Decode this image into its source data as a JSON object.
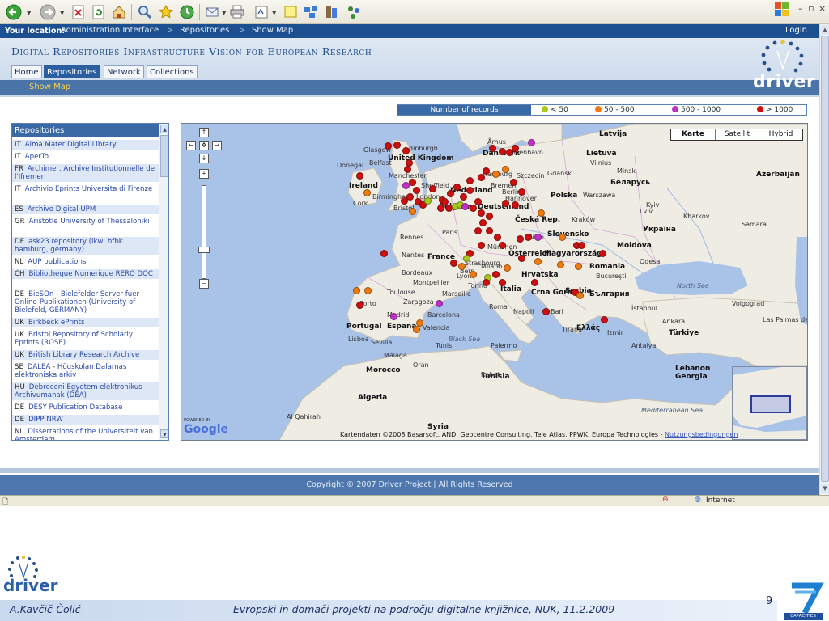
{
  "location_bar": {
    "label": "Your location:",
    "crumbs": [
      "Administration Interface",
      "Repositories",
      "Show Map"
    ],
    "separator": ">",
    "login": "Login"
  },
  "header": {
    "title": "Digital Repositories Infrastructure Vision for European Research",
    "tabs": [
      "Home",
      "Repositories",
      "Network",
      "Collections"
    ],
    "active_tab": "Repositories",
    "sub_link": "Show Map",
    "logo_text": "driver"
  },
  "legend": {
    "heading": "Number of records",
    "items": [
      {
        "label": "< 50",
        "color": "#a8c81c"
      },
      {
        "label": "50 - 500",
        "color": "#f07a12"
      },
      {
        "label": "500 - 1000",
        "color": "#c030c8"
      },
      {
        "label": "> 1000",
        "color": "#cc1010"
      }
    ]
  },
  "repositories": {
    "heading": "Repositories",
    "items": [
      {
        "cc": "IT",
        "name": "Alma Mater Digital Library"
      },
      {
        "cc": "IT",
        "name": "AperTo"
      },
      {
        "cc": "FR",
        "name": "Archimer, Archive Institutionnelle de l'Ifremer"
      },
      {
        "cc": "IT",
        "name": "Archivio Eprints Universita di Firenze"
      },
      {
        "cc": "ES",
        "name": "Archivo Digital UPM"
      },
      {
        "cc": "GR",
        "name": "Aristotle University of Thessaloniki"
      },
      {
        "cc": "DE",
        "name": "ask23 repository (lkw, hfbk hamburg, germany)"
      },
      {
        "cc": "NL",
        "name": "AUP publications"
      },
      {
        "cc": "CH",
        "name": "Bibliotheque Numerique RERO DOC"
      },
      {
        "cc": "DE",
        "name": "BieSOn - Bielefelder Server fuer Online-Publikationen (University of Bielefeld, GERMANY)"
      },
      {
        "cc": "UK",
        "name": "Birkbeck ePrints"
      },
      {
        "cc": "UK",
        "name": "Bristol Repository of Scholarly Eprints (ROSE)"
      },
      {
        "cc": "UK",
        "name": "British Library Research Archive"
      },
      {
        "cc": "SE",
        "name": "DALEA - Högskolan Dalarnas elektroniska arkiv"
      },
      {
        "cc": "HU",
        "name": "Debreceni Egyetem elektronikus Archivumanak (DEA)"
      },
      {
        "cc": "DE",
        "name": "DESY Publication Database"
      },
      {
        "cc": "DE",
        "name": "DIPP NRW"
      },
      {
        "cc": "NL",
        "name": "Dissertations of the Universiteit van Amsterdam"
      }
    ]
  },
  "map": {
    "type_buttons": [
      "Karte",
      "Satellit",
      "Hybrid"
    ],
    "selected_type": "Karte",
    "labels": [
      {
        "t": "Latvija",
        "c": "country"
      },
      {
        "t": "Danmark",
        "c": "country"
      },
      {
        "t": "København",
        "c": "city"
      },
      {
        "t": "Århus",
        "c": "city"
      },
      {
        "t": "Lietuva",
        "c": "country"
      },
      {
        "t": "Vilnius",
        "c": "city"
      },
      {
        "t": "Minsk",
        "c": "city"
      },
      {
        "t": "Беларусь",
        "c": "country"
      },
      {
        "t": "Glasgow",
        "c": "city"
      },
      {
        "t": "Edinburgh",
        "c": "city"
      },
      {
        "t": "United Kingdom",
        "c": "country"
      },
      {
        "t": "Donegal",
        "c": "city"
      },
      {
        "t": "Belfast",
        "c": "city"
      },
      {
        "t": "Manchester",
        "c": "city"
      },
      {
        "t": "Sheffield",
        "c": "city"
      },
      {
        "t": "Ireland",
        "c": "country"
      },
      {
        "t": "Birmingham",
        "c": "city"
      },
      {
        "t": "Cork",
        "c": "city"
      },
      {
        "t": "London",
        "c": "city"
      },
      {
        "t": "Bristol",
        "c": "city"
      },
      {
        "t": "Nederland",
        "c": "country"
      },
      {
        "t": "Hamburg",
        "c": "city"
      },
      {
        "t": "Szczecin",
        "c": "city"
      },
      {
        "t": "Gdańsk",
        "c": "city"
      },
      {
        "t": "Bremen",
        "c": "city"
      },
      {
        "t": "Berlin",
        "c": "city"
      },
      {
        "t": "Hannover",
        "c": "city"
      },
      {
        "t": "Polska",
        "c": "country"
      },
      {
        "t": "Warszawa",
        "c": "city"
      },
      {
        "t": "Deutschland",
        "c": "country"
      },
      {
        "t": "Belgium",
        "c": "country"
      },
      {
        "t": "Česká Rep.",
        "c": "country"
      },
      {
        "t": "Kraków",
        "c": "city"
      },
      {
        "t": "Lviv",
        "c": "city"
      },
      {
        "t": "Kyiv",
        "c": "city"
      },
      {
        "t": "Україна",
        "c": "country"
      },
      {
        "t": "Kharkov",
        "c": "city"
      },
      {
        "t": "Rennes",
        "c": "city"
      },
      {
        "t": "Paris",
        "c": "city"
      },
      {
        "t": "Strasbourg",
        "c": "city"
      },
      {
        "t": "München",
        "c": "city"
      },
      {
        "t": "Wien",
        "c": "city"
      },
      {
        "t": "Slovensko",
        "c": "country"
      },
      {
        "t": "Österreich",
        "c": "country"
      },
      {
        "t": "Nantes",
        "c": "city"
      },
      {
        "t": "France",
        "c": "country"
      },
      {
        "t": "Bern",
        "c": "city"
      },
      {
        "t": "Milano",
        "c": "city"
      },
      {
        "t": "Magyarország",
        "c": "country"
      },
      {
        "t": "Moldova",
        "c": "country"
      },
      {
        "t": "Odesa",
        "c": "city"
      },
      {
        "t": "Bordeaux",
        "c": "city"
      },
      {
        "t": "Lyon",
        "c": "city"
      },
      {
        "t": "Torino",
        "c": "city"
      },
      {
        "t": "Hrvatska",
        "c": "country"
      },
      {
        "t": "Romania",
        "c": "country"
      },
      {
        "t": "Bucureşti",
        "c": "city"
      },
      {
        "t": "Toulouse",
        "c": "city"
      },
      {
        "t": "Montpellier",
        "c": "city"
      },
      {
        "t": "Marseille",
        "c": "city"
      },
      {
        "t": "Italia",
        "c": "country"
      },
      {
        "t": "Crna Gora",
        "c": "country"
      },
      {
        "t": "Serbia",
        "c": "country"
      },
      {
        "t": "България",
        "c": "country"
      },
      {
        "t": "Porto",
        "c": "city"
      },
      {
        "t": "Zaragoza",
        "c": "city"
      },
      {
        "t": "Barcelona",
        "c": "city"
      },
      {
        "t": "Roma",
        "c": "city"
      },
      {
        "t": "Napoli",
        "c": "city"
      },
      {
        "t": "Bari",
        "c": "city"
      },
      {
        "t": "Tirana",
        "c": "city"
      },
      {
        "t": "İstanbul",
        "c": "city"
      },
      {
        "t": "Portugal",
        "c": "country"
      },
      {
        "t": "Madrid",
        "c": "city"
      },
      {
        "t": "España",
        "c": "country"
      },
      {
        "t": "Valencia",
        "c": "city"
      },
      {
        "t": "Ελλάς",
        "c": "country"
      },
      {
        "t": "Ankara",
        "c": "city"
      },
      {
        "t": "Türkiye",
        "c": "country"
      },
      {
        "t": "Lisboa",
        "c": "city"
      },
      {
        "t": "Sevilla",
        "c": "city"
      },
      {
        "t": "Palermo",
        "c": "city"
      },
      {
        "t": "Tunis",
        "c": "city"
      },
      {
        "t": "Izmir",
        "c": "city"
      },
      {
        "t": "Antalya",
        "c": "city"
      },
      {
        "t": "Málaga",
        "c": "city"
      },
      {
        "t": "Oran",
        "c": "city"
      },
      {
        "t": "Tunisia",
        "c": "country"
      },
      {
        "t": "Rabat",
        "c": "city"
      },
      {
        "t": "Morocco",
        "c": "country"
      },
      {
        "t": "Algeria",
        "c": "country"
      },
      {
        "t": "Syria",
        "c": "country"
      },
      {
        "t": "Lebanon",
        "c": "country"
      },
      {
        "t": "Georgia",
        "c": "country"
      },
      {
        "t": "Volgograd",
        "c": "city"
      },
      {
        "t": "Samara",
        "c": "city"
      },
      {
        "t": "Azerbaijan",
        "c": "country"
      },
      {
        "t": "Las Palmas de Gran Canaria",
        "c": "city"
      },
      {
        "t": "Al Qahirah",
        "c": "city"
      },
      {
        "t": "Mediterranean Sea",
        "c": "sea"
      },
      {
        "t": "Black Sea",
        "c": "sea"
      },
      {
        "t": "North Sea",
        "c": "sea"
      }
    ],
    "powered": "POWERED BY",
    "brand": "Google",
    "attribution": "Kartendaten ©2008 Basarsoft, AND, Geocentre Consulting, Tele Atlas, PPWK, Europa Technologies -",
    "terms_link": "Nutzungsbedingungen"
  },
  "footer": {
    "copyright": "Copyright © 2007 Driver Project | All Rights Reserved"
  },
  "status_bar": {
    "zone": "Internet"
  },
  "slide": {
    "logo_text": "driver",
    "author": "A.Kavčič-Čolić",
    "event": "Evropski in domači projekti na področju digitalne knjižnice, NUK, 11.2.2009",
    "page": "9",
    "badge": "CAPACITIES"
  }
}
